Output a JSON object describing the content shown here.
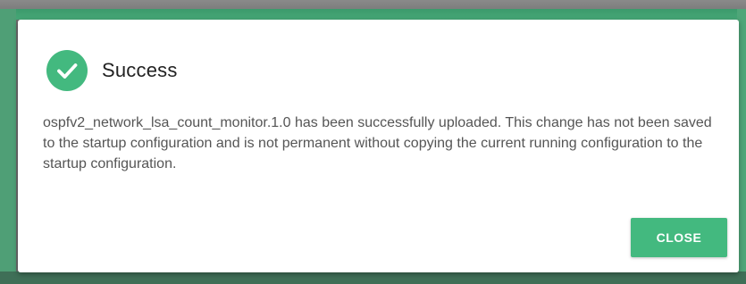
{
  "dialog": {
    "icon": "check-circle-icon",
    "title": "Success",
    "message": "ospfv2_network_lsa_count_monitor.1.0 has been successfully uploaded. This change has not been saved to the startup configuration and is not permanent without copying the current running configuration to the startup configuration.",
    "close_label": "CLOSE"
  },
  "colors": {
    "accent": "#43b97f",
    "title_text": "#222222",
    "body_text": "#555555"
  }
}
